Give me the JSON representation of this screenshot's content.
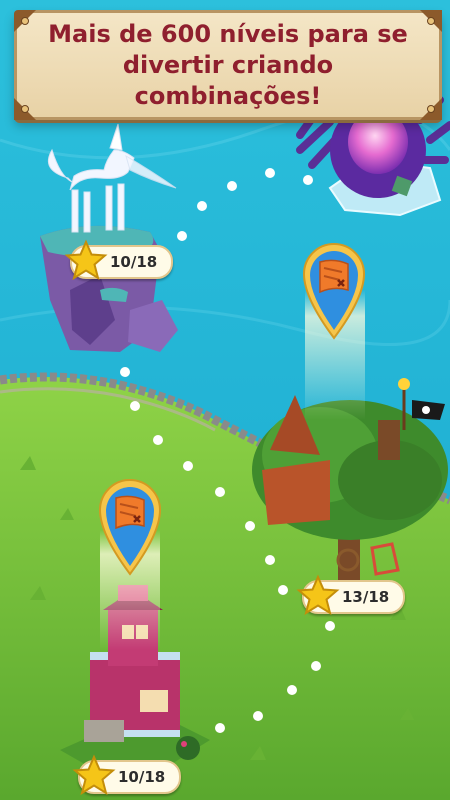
{
  "banner": {
    "text": "Mais de 600 níveis para se divertir criando combinações!"
  },
  "levels": [
    {
      "label": "10/18",
      "icon": "star-icon"
    },
    {
      "label": "13/18",
      "icon": "star-icon"
    },
    {
      "label": "10/18",
      "icon": "star-icon"
    }
  ],
  "pins": [
    {
      "icon": "treasure-map-icon"
    },
    {
      "icon": "treasure-map-icon"
    }
  ],
  "colors": {
    "sea": "#29b6d6",
    "grass": "#7cc43a",
    "banner_text": "#8f1f2e",
    "star": "#f5c518"
  }
}
